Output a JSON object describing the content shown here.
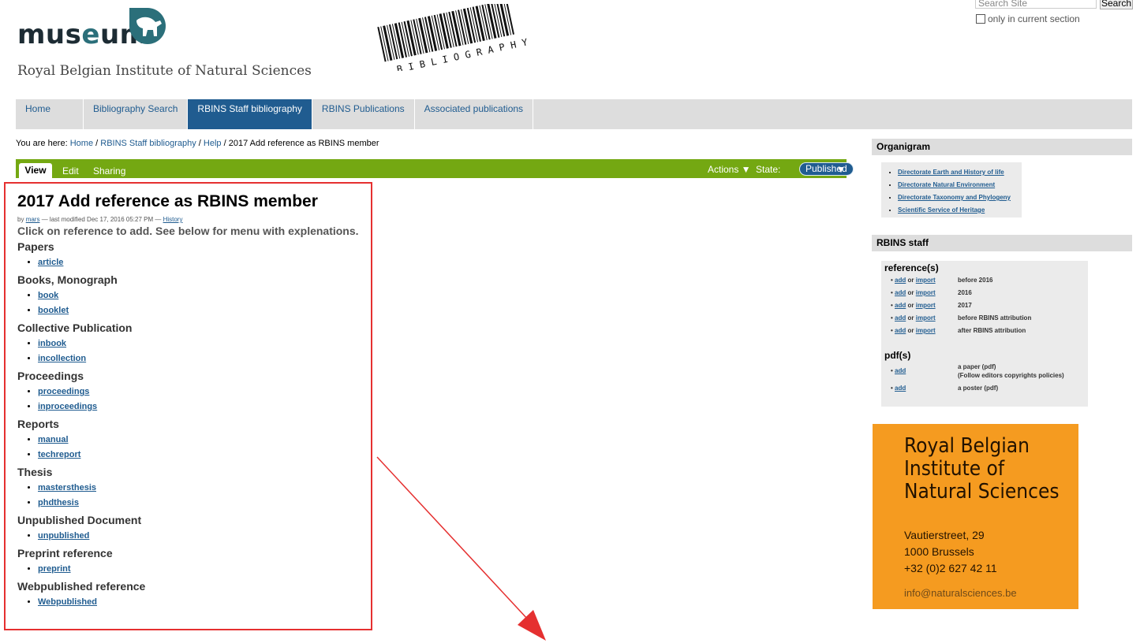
{
  "header": {
    "logo_word_a": "mus",
    "logo_word_e": "e",
    "logo_word_b": "um",
    "logo_subtitle": "Royal Belgian Institute of Natural Sciences",
    "barcode_text": "BIBLIOGRAPHY",
    "search_placeholder": "Search Site",
    "search_button": "Search",
    "only_current": "only in current section"
  },
  "nav": {
    "tabs": [
      "Home",
      "Bibliography Search",
      "RBINS Staff bibliography",
      "RBINS Publications",
      "Associated publications"
    ],
    "active_index": 2
  },
  "breadcrumb": {
    "prefix": "You are here:",
    "items": [
      "Home",
      "RBINS Staff bibliography",
      "Help"
    ],
    "current": "2017 Add reference as RBINS member",
    "sep": "/"
  },
  "editbar": {
    "view": "View",
    "edit": "Edit",
    "sharing": "Sharing",
    "actions": "Actions ▼",
    "state_label": "State:",
    "state_value": "Published",
    "state_arrow": "▼"
  },
  "content": {
    "title": "2017 Add reference as RBINS member",
    "by": "by",
    "author": "mars",
    "modified": "— last modified Dec 17, 2016 05:27 PM —",
    "history": "History",
    "intro": "Click on reference to add. See below for menu with explenations.",
    "sections": [
      {
        "heading": "Papers",
        "items": [
          "article"
        ]
      },
      {
        "heading": "Books, Monograph",
        "items": [
          "book",
          "booklet"
        ]
      },
      {
        "heading": "Collective Publication",
        "items": [
          "inbook",
          "incollection"
        ]
      },
      {
        "heading": "Proceedings",
        "items": [
          "proceedings",
          "inproceedings"
        ]
      },
      {
        "heading": "Reports",
        "items": [
          "manual",
          "techreport"
        ]
      },
      {
        "heading": "Thesis",
        "items": [
          "mastersthesis",
          "phdthesis"
        ]
      },
      {
        "heading": "Unpublished Document",
        "items": [
          "unpublished"
        ]
      },
      {
        "heading": "Preprint reference",
        "items": [
          "preprint"
        ]
      },
      {
        "heading": "Webpublished reference",
        "items": [
          "Webpublished"
        ]
      }
    ]
  },
  "sidebar": {
    "organigram_title": "Organigram",
    "organigram_items": [
      "Directorate Earth and History of life",
      "Directorate Natural Environment",
      "Directorate Taxonomy and Phylogeny",
      "Scientific Service of Heritage"
    ],
    "staff_title": "RBINS staff",
    "references_heading": "reference(s)",
    "add": "add",
    "or": "or",
    "import": "import",
    "reference_rows": [
      "before 2016",
      "2016",
      "2017",
      "before RBINS attribution",
      "after RBINS attribution"
    ],
    "pdfs_heading": "pdf(s)",
    "pdf_rows": [
      {
        "line1": "a paper (pdf)",
        "line2": "(Follow editors copyrights policies)"
      },
      {
        "line1": "a poster (pdf)",
        "line2": ""
      }
    ]
  },
  "card": {
    "title": "Royal Belgian Institute of Natural Sciences",
    "address1": "Vautierstreet, 29",
    "address2": "1000 Brussels",
    "phone": "+32 (0)2 627 42 11",
    "email": "info@naturalsciences.be"
  },
  "colors": {
    "nav_active": "#205c90",
    "editbar": "#74a812",
    "card": "#f59b20",
    "annotation": "#e53030"
  }
}
